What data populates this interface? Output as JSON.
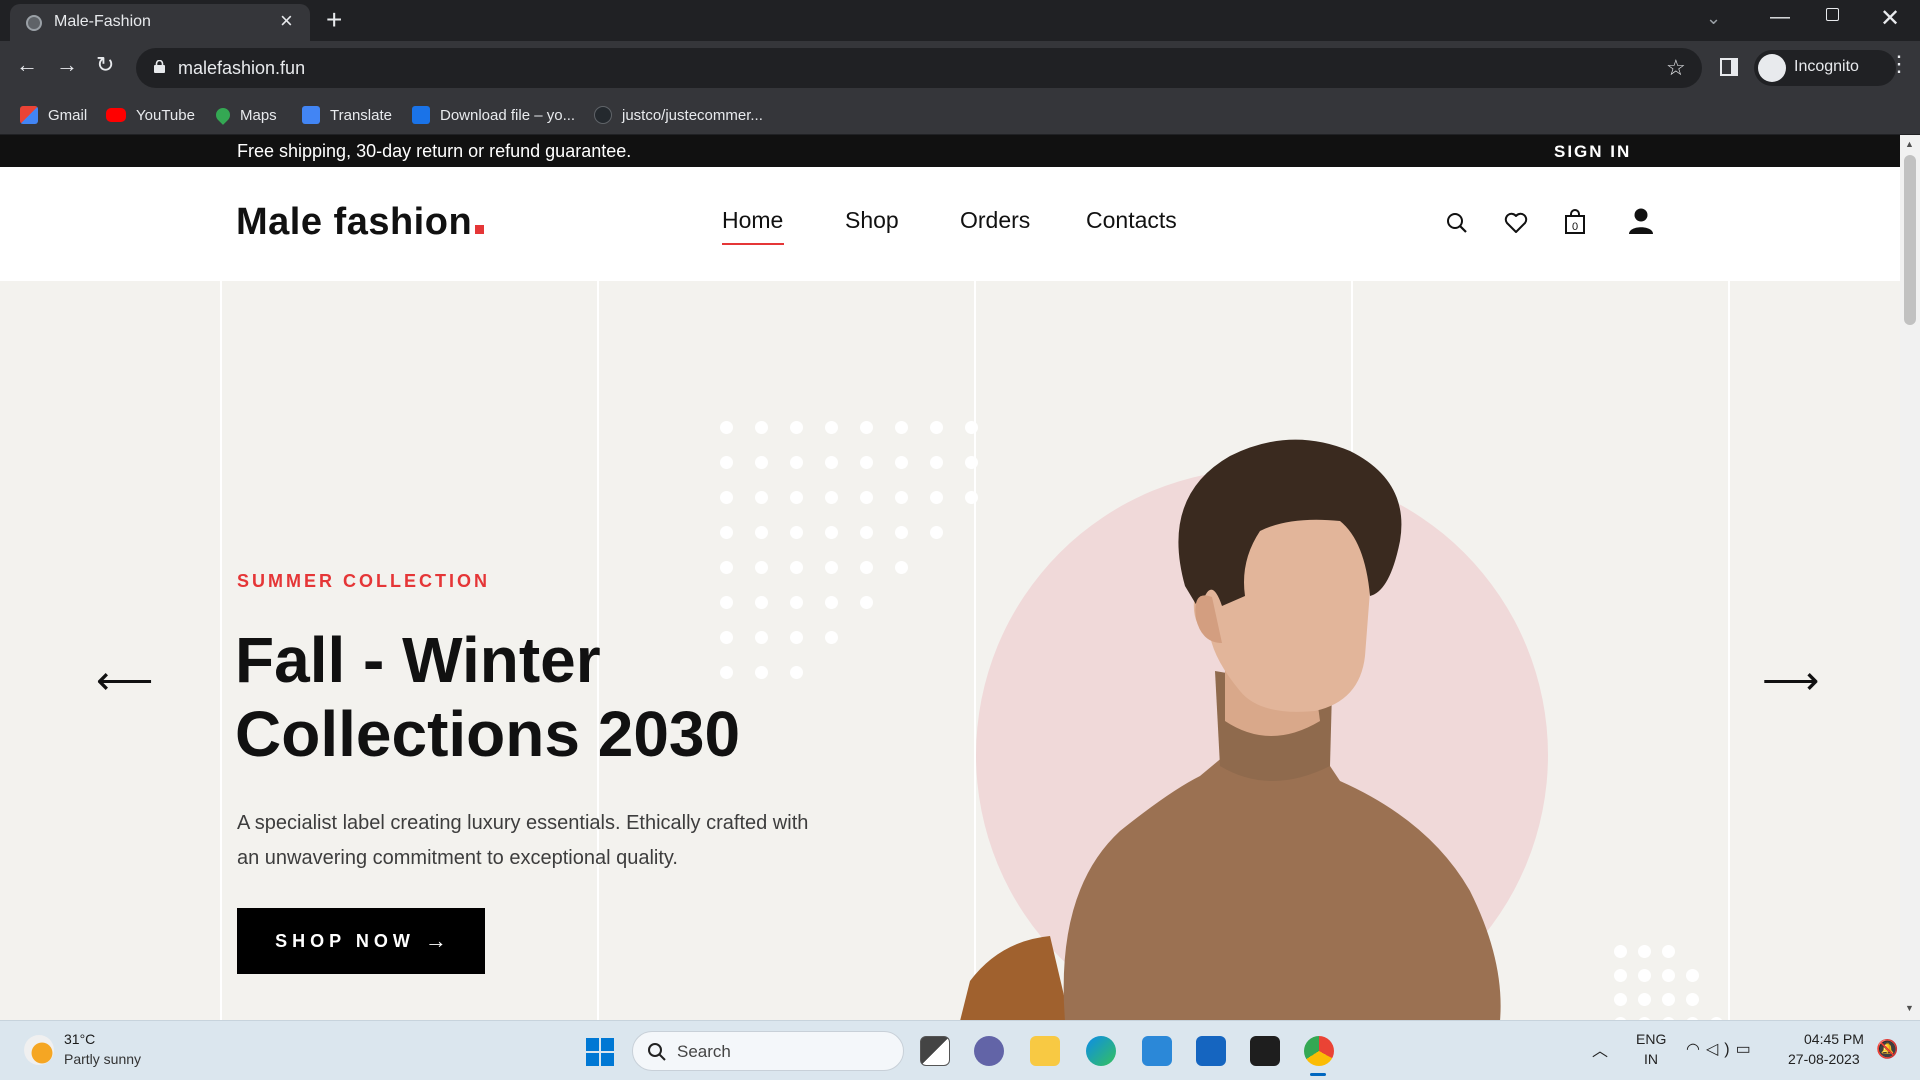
{
  "browser": {
    "tab_title": "Male-Fashion",
    "url": "malefashion.fun",
    "profile_label": "Incognito",
    "bookmarks": [
      {
        "label": "Gmail",
        "icon": "gmail-icon",
        "color": "#ea4335"
      },
      {
        "label": "YouTube",
        "icon": "youtube-icon",
        "color": "#ff0000"
      },
      {
        "label": "Maps",
        "icon": "maps-icon",
        "color": "#34a853"
      },
      {
        "label": "Translate",
        "icon": "translate-icon",
        "color": "#4285f4"
      },
      {
        "label": "Download file – yo...",
        "icon": "download-icon",
        "color": "#1a73e8"
      },
      {
        "label": "justco/justecommer...",
        "icon": "github-icon",
        "color": "#24292e"
      }
    ]
  },
  "site": {
    "announcement": "Free shipping, 30-day return or refund guarantee.",
    "sign_in": "SIGN IN",
    "logo": "Male fashion",
    "nav": [
      "Home",
      "Shop",
      "Orders",
      "Contacts"
    ],
    "active_nav": "Home",
    "cart_count": "0",
    "accent_color": "#e53637",
    "hero": {
      "subtitle": "SUMMER COLLECTION",
      "headline": "Fall - Winter Collections 2030",
      "description": "A specialist label creating luxury essentials. Ethically crafted with an unwavering commitment to exceptional quality.",
      "cta": "SHOP NOW"
    }
  },
  "taskbar": {
    "temperature": "31°C",
    "weather": "Partly sunny",
    "search_placeholder": "Search",
    "lang_top": "ENG",
    "lang_bottom": "IN",
    "time": "04:45 PM",
    "date": "27-08-2023"
  }
}
